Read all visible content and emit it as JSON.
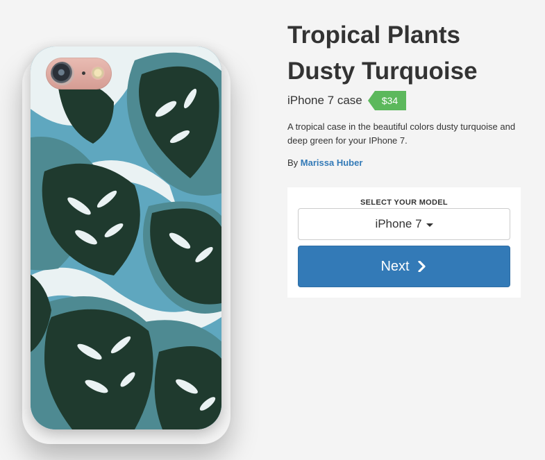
{
  "product": {
    "title_line1": "Tropical Plants",
    "title_line2": "Dusty Turquoise",
    "subtitle": "iPhone 7 case",
    "price": "$34",
    "description": "A tropical case in the beautiful colors dusty turquoise and deep green for your IPhone 7.",
    "by_label": "By",
    "author": "Marissa Huber"
  },
  "selector": {
    "label": "SELECT YOUR MODEL",
    "selected_model": "iPhone 7",
    "next_label": "Next"
  },
  "colors": {
    "price_tag": "#5cb85c",
    "button": "#337ab7",
    "author_link": "#337ab7",
    "leaf_dark": "#1f3a2e",
    "leaf_muted": "#4e8a92",
    "case_bg": "#5fa7bf"
  },
  "icons": {
    "dropdown": "caret-down-icon",
    "next": "chevron-right-icon"
  }
}
